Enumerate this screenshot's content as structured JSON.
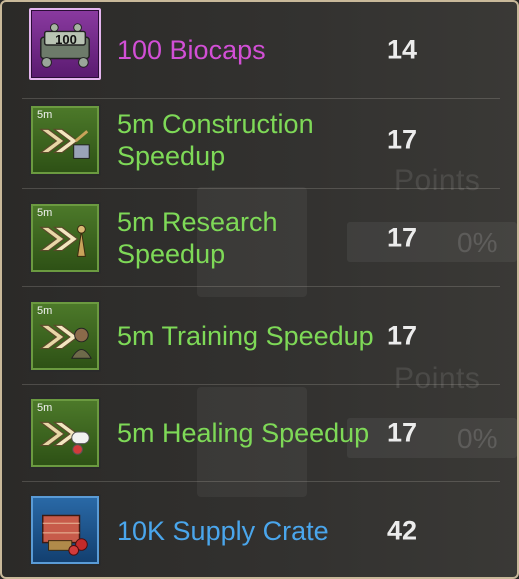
{
  "rewards": [
    {
      "icon": "biocaps-icon",
      "icon_label": "100",
      "name": "100 Biocaps",
      "points": "14",
      "rarity_color": "#d24fd6"
    },
    {
      "icon": "construction-speedup-icon",
      "icon_label": "5m",
      "name": "5m Construction Speedup",
      "points": "17",
      "rarity_color": "#7ed957"
    },
    {
      "icon": "research-speedup-icon",
      "icon_label": "5m",
      "name": "5m Research Speedup",
      "points": "17",
      "rarity_color": "#7ed957"
    },
    {
      "icon": "training-speedup-icon",
      "icon_label": "5m",
      "name": "5m Training Speedup",
      "points": "17",
      "rarity_color": "#7ed957"
    },
    {
      "icon": "healing-speedup-icon",
      "icon_label": "5m",
      "name": "5m Healing Speedup",
      "points": "17",
      "rarity_color": "#7ed957"
    },
    {
      "icon": "supply-crate-icon",
      "icon_label": "",
      "name": "10K Supply Crate",
      "points": "42",
      "rarity_color": "#4aa6ec"
    }
  ],
  "background": {
    "points_label": "Points",
    "progress_text": "0%"
  }
}
